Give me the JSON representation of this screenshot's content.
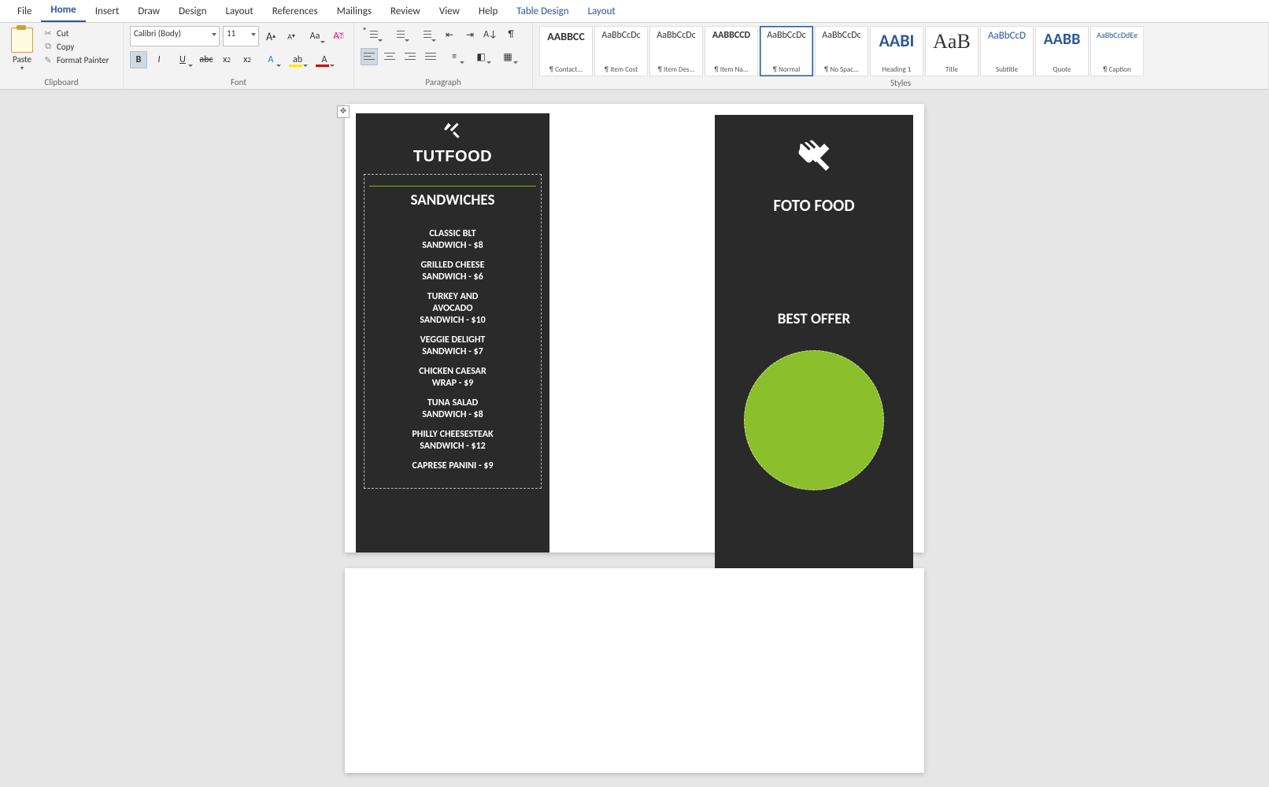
{
  "tabs": {
    "file": "File",
    "home": "Home",
    "insert": "Insert",
    "draw": "Draw",
    "design": "Design",
    "layout": "Layout",
    "references": "References",
    "mailings": "Mailings",
    "review": "Review",
    "view": "View",
    "help": "Help",
    "table_design": "Table Design",
    "tbl_layout": "Layout"
  },
  "clipboard": {
    "group": "Clipboard",
    "paste": "Paste",
    "cut": "Cut",
    "copy": "Copy",
    "format_painter": "Format Painter"
  },
  "font": {
    "group": "Font",
    "name": "Calibri (Body)",
    "size": "11",
    "bold": "B",
    "italic": "I",
    "underline": "U",
    "strike": "abc",
    "sub": "x",
    "sup": "x"
  },
  "paragraph": {
    "group": "Paragraph"
  },
  "styles": {
    "group": "Styles",
    "items": [
      {
        "preview": "AABBCC",
        "name": "¶ Contact...",
        "cls": "s1"
      },
      {
        "preview": "AaBbCcDc",
        "name": "¶ Item Cost",
        "cls": "s2"
      },
      {
        "preview": "AaBbCcDc",
        "name": "¶ Item Des...",
        "cls": "s2"
      },
      {
        "preview": "AABBCCD",
        "name": "¶ Item Na...",
        "cls": "s3"
      },
      {
        "preview": "AaBbCcDc",
        "name": "¶ Normal",
        "cls": "s2"
      },
      {
        "preview": "AaBbCcDc",
        "name": "¶ No Spac...",
        "cls": "s2"
      },
      {
        "preview": "AABI",
        "name": "Heading 1",
        "cls": "s4"
      },
      {
        "preview": "AaB",
        "name": "Title",
        "cls": "s5"
      },
      {
        "preview": "AaBbCcD",
        "name": "Subtitle",
        "cls": "s6"
      },
      {
        "preview": "AABB",
        "name": "Quote",
        "cls": "s7"
      },
      {
        "preview": "AaBbCcDdEe",
        "name": "¶ Caption",
        "cls": "s8"
      }
    ],
    "selected": 4
  },
  "doc": {
    "left": {
      "brand": "TUTFOOD",
      "section": "SANDWICHES",
      "items": [
        [
          "CLASSIC BLT",
          "SANDWICH - $8"
        ],
        [
          "GRILLED CHEESE",
          "SANDWICH - $6"
        ],
        [
          "TURKEY AND",
          "AVOCADO",
          "SANDWICH - $10"
        ],
        [
          "VEGGIE DELIGHT",
          "SANDWICH - $7"
        ],
        [
          "CHICKEN CAESAR",
          "WRAP - $9"
        ],
        [
          "TUNA SALAD",
          "SANDWICH - $8"
        ],
        [
          "PHILLY CHEESESTEAK",
          "SANDWICH - $12"
        ],
        [
          "CAPRESE PANINI - $9"
        ]
      ]
    },
    "right": {
      "brand": "FOTO FOOD",
      "offer": "BEST OFFER"
    }
  },
  "colors": {
    "accent_green": "#8bbf2b"
  }
}
